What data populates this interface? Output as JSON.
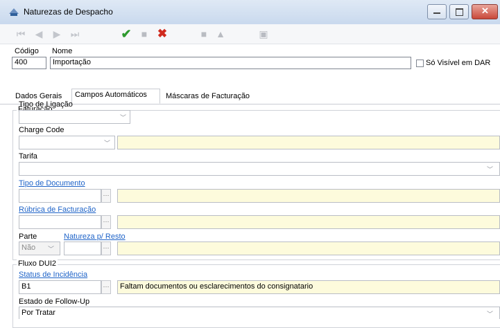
{
  "window": {
    "title": "Naturezas de Despacho"
  },
  "toolbar": {
    "first": "⏮",
    "prev": "◀",
    "next": "▶",
    "last": "⏭",
    "confirm": "✔",
    "stop": "■",
    "cancel": "✖",
    "doc": "■",
    "search": "▲",
    "print": "▣"
  },
  "header": {
    "codigo_label": "Código",
    "nome_label": "Nome",
    "codigo_value": "400",
    "nome_value": "Importação",
    "so_visivel_label": "Só Visível em DAR",
    "so_visivel_checked": false
  },
  "tabs": [
    {
      "label": "Dados Gerais",
      "active": false
    },
    {
      "label": "Campos Automáticos",
      "active": true
    },
    {
      "label": "Máscaras de Facturação",
      "active": false
    }
  ],
  "faturacao": {
    "legend": "Faturação",
    "tipo_ligacao_label": "Tipo de Ligação",
    "tipo_ligacao_value": "",
    "charge_code_label": "Charge Code",
    "charge_code_value": "",
    "charge_code_desc": "",
    "tarifa_label": "Tarifa",
    "tarifa_value": "",
    "tipo_documento_label": "Tipo de Documento",
    "tipo_documento_value": "",
    "tipo_documento_desc": "",
    "rubrica_label": "Rúbrica de Facturação",
    "rubrica_value": "",
    "rubrica_desc": "",
    "parte_label": "Parte",
    "parte_value": "Não",
    "natureza_resto_label": "Natureza p/ Resto",
    "natureza_resto_value": "",
    "natureza_resto_desc": ""
  },
  "fluxo": {
    "legend": "Fluxo DUI2",
    "status_label": "Status de Incidência",
    "status_code": "B1",
    "status_desc": "Faltam documentos ou esclarecimentos do consignatario",
    "estado_label": "Estado de Follow-Up",
    "estado_value": "Por Tratar"
  },
  "colors": {
    "link": "#1e63c8",
    "readonly_field": "#fdfbdc",
    "confirm_green": "#2e9a2e",
    "cancel_red": "#d02a1e"
  }
}
